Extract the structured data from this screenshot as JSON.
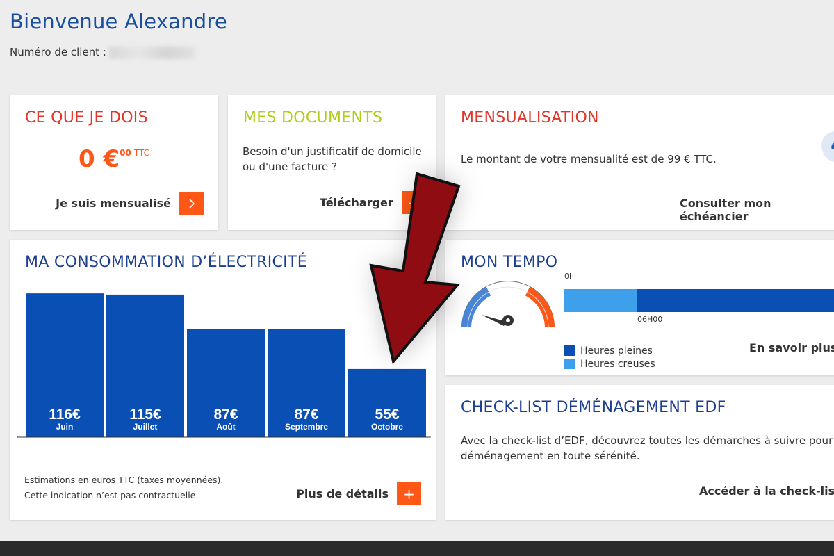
{
  "header": {
    "greeting": "Bienvenue Alexandre",
    "client_label": "Numéro de client :"
  },
  "card_dois": {
    "title": "CE QUE JE DOIS",
    "amount_main": "0 €",
    "amount_cents": "00",
    "amount_suffix": "TTC",
    "action_label": "Je suis mensualisé",
    "action_icon": "chevron-right-icon"
  },
  "card_docs": {
    "title": "MES DOCUMENTS",
    "text": "Besoin d'un justificatif de domicile ou d'une facture ?",
    "action_label": "Télécharger"
  },
  "card_mens": {
    "title": "MENSUALISATION",
    "text": "Le montant de votre mensualité est de 99 € TTC.",
    "action_label": "Consulter mon échéancier"
  },
  "card_conso": {
    "title": "MA CONSOMMATION D’ÉLECTRICITÉ",
    "note1": "Estimations en euros TTC (taxes moyennées).",
    "note2": "Cette indication n’est pas contractuelle",
    "action_label": "Plus de détails",
    "action_symbol": "+"
  },
  "chart_data": {
    "type": "bar",
    "categories": [
      "Juin",
      "Juillet",
      "Août",
      "Septembre",
      "Octobre"
    ],
    "values": [
      116,
      115,
      87,
      87,
      55
    ],
    "value_labels": [
      "116€",
      "115€",
      "87€",
      "87€",
      "55€"
    ],
    "ylim": [
      0,
      120
    ],
    "bar_color": "#0a4fb3",
    "grid": false
  },
  "card_tempo": {
    "title": "MON TEMPO",
    "time_start": "0h",
    "time_mark": "06H00",
    "legend": [
      {
        "label": "Heures pleines",
        "color": "#0a4fb3"
      },
      {
        "label": "Heures creuses",
        "color": "#3ea0ea"
      }
    ],
    "action_label": "En savoir plus"
  },
  "card_check": {
    "title": "CHECK-LIST DÉMÉNAGEMENT EDF",
    "text_line1": "Avec la check-list d’EDF, découvrez toutes les démarches à suivre pour un",
    "text_line2": "déménagement en toute sérénité.",
    "action_label": "Accéder à la check-list"
  },
  "colors": {
    "accent_orange": "#fe5716",
    "title_red": "#e2352a",
    "title_green": "#b4cc1a",
    "title_blue": "#1d3f8f",
    "arrow_red": "#8e0c12"
  }
}
